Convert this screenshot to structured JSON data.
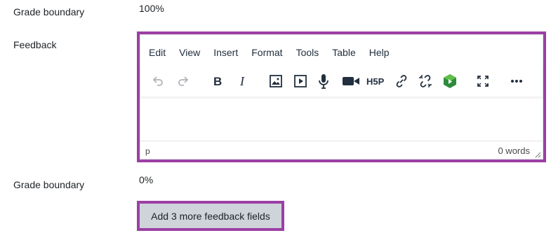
{
  "rows": [
    {
      "label": "Grade boundary",
      "value": "100%"
    },
    {
      "label": "Feedback"
    },
    {
      "label": "Grade boundary",
      "value": "0%"
    }
  ],
  "editor": {
    "menu": [
      "Edit",
      "View",
      "Insert",
      "Format",
      "Tools",
      "Table",
      "Help"
    ],
    "toolbar_icons": [
      "undo-icon",
      "redo-icon",
      "bold-icon",
      "italic-icon",
      "image-icon",
      "media-icon",
      "microphone-icon",
      "video-camera-icon",
      "h5p-icon",
      "link-icon",
      "unlink-icon",
      "panopto-icon",
      "fullscreen-icon",
      "more-icon"
    ],
    "status_path": "p",
    "word_count": "0 words"
  },
  "add_button": {
    "label": "Add 3 more feedback fields"
  },
  "colors": {
    "highlight": "#9c3fa5",
    "button_bg": "#ced4da",
    "icon": "#222f3e"
  }
}
